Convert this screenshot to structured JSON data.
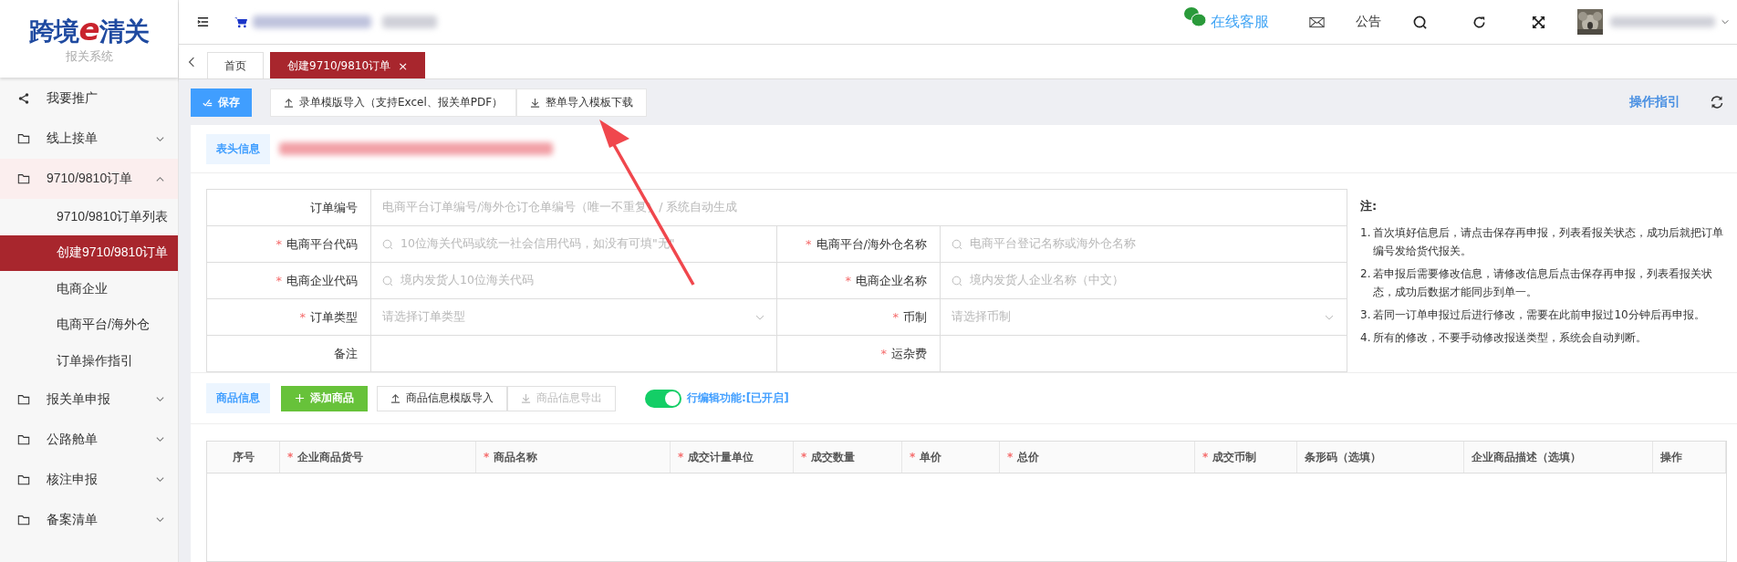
{
  "logo": {
    "title_a": "跨境",
    "title_e": "e",
    "title_b": "清关",
    "subtitle": "报关系统"
  },
  "header": {
    "service_link": "在线客服",
    "notice": "公告"
  },
  "tabs": [
    {
      "label": "首页",
      "selected": false
    },
    {
      "label": "创建9710/9810订单",
      "selected": true,
      "close": "×"
    }
  ],
  "sidebar": {
    "items": [
      {
        "label": "我要推广",
        "kind": "link"
      },
      {
        "label": "线上接单",
        "kind": "group",
        "expanded": false
      },
      {
        "label": "9710/9810订单",
        "kind": "group",
        "expanded": true,
        "children": [
          {
            "label": "9710/9810订单列表",
            "selected": false
          },
          {
            "label": "创建9710/9810订单",
            "selected": true
          },
          {
            "label": "电商企业",
            "selected": false
          },
          {
            "label": "电商平台/海外仓",
            "selected": false
          },
          {
            "label": "订单操作指引",
            "selected": false
          }
        ]
      },
      {
        "label": "报关单申报",
        "kind": "group",
        "expanded": false
      },
      {
        "label": "公路舱单",
        "kind": "group",
        "expanded": false
      },
      {
        "label": "核注申报",
        "kind": "group",
        "expanded": false
      },
      {
        "label": "备案清单",
        "kind": "group",
        "expanded": false
      }
    ]
  },
  "toolbar": {
    "buttons": [
      {
        "label": "保存",
        "kind": "primary"
      },
      {
        "label": "录单模版导入（支持Excel、报关单PDF）",
        "kind": "upload"
      },
      {
        "label": "整单导入模板下载",
        "kind": "download"
      }
    ],
    "guide_link": "操作指引"
  },
  "header_section": {
    "tag": "表头信息"
  },
  "order_form": {
    "rows": [
      [
        {
          "label": "订单编号",
          "kind": "text",
          "placeholder": "电商平台订单编号/海外仓订仓单编号（唯一不重复）/ 系统自动生成"
        }
      ],
      [
        {
          "label": "电商平台代码",
          "mark": "*",
          "kind": "search",
          "placeholder": "10位海关代码或统一社会信用代码，如没有可填\"无\""
        },
        {
          "label": "电商平台/海外仓名称",
          "mark": "*",
          "kind": "search",
          "placeholder": "电商平台登记名称或海外仓名称"
        }
      ],
      [
        {
          "label": "电商企业代码",
          "mark": "*",
          "kind": "search",
          "placeholder": "境内发货人10位海关代码"
        },
        {
          "label": "电商企业名称",
          "mark": "*",
          "kind": "search",
          "placeholder": "境内发货人企业名称（中文）"
        }
      ],
      [
        {
          "label": "订单类型",
          "mark": "*",
          "kind": "select",
          "placeholder": "请选择订单类型"
        },
        {
          "label": "币制",
          "mark": "*",
          "kind": "select",
          "placeholder": "请选择币制"
        }
      ],
      [
        {
          "label": "备注",
          "kind": "text"
        },
        {
          "label": "运杂费",
          "mark": "*",
          "kind": "text"
        }
      ]
    ]
  },
  "notes": {
    "title": "注:",
    "items": [
      {
        "number": "1.",
        "text": "首次填好信息后，请点击保存再申报，列表看报关状态，成功后就把订单编号发给货代报关。"
      },
      {
        "number": "2.",
        "text": "若申报后需要修改信息，请修改信息后点击保存再申报，列表看报关状态，成功后数据才能同步到单一。"
      },
      {
        "number": "3.",
        "text": "若同一订单申报过后进行修改，需要在此前申报过10分钟后再申报。"
      },
      {
        "number": "4.",
        "text": "所有的修改，不要手动修改报送类型，系统会自动判断。"
      }
    ]
  },
  "goods_section": {
    "tag": "商品信息",
    "buttons": [
      {
        "label": "添加商品",
        "kind": "add",
        "disabled": false
      },
      {
        "label": "商品信息模版导入",
        "kind": "upload",
        "disabled": false
      },
      {
        "label": "商品信息导出",
        "kind": "download",
        "disabled": true
      }
    ],
    "row_edit": {
      "on": true,
      "label": "行编辑功能:[已开启]"
    }
  },
  "goods_table": {
    "columns": [
      {
        "label": "序号"
      },
      {
        "label": "企业商品货号",
        "mark": "*"
      },
      {
        "label": "商品名称",
        "mark": "*"
      },
      {
        "label": "成交计量单位",
        "mark": "*"
      },
      {
        "label": "成交数量",
        "mark": "*"
      },
      {
        "label": "单价",
        "mark": "*"
      },
      {
        "label": "总价",
        "mark": "*"
      },
      {
        "label": "成交币制",
        "mark": "*"
      },
      {
        "label": "条形码（选填）"
      },
      {
        "label": "企业商品描述（选填）"
      },
      {
        "label": "操作"
      }
    ]
  }
}
